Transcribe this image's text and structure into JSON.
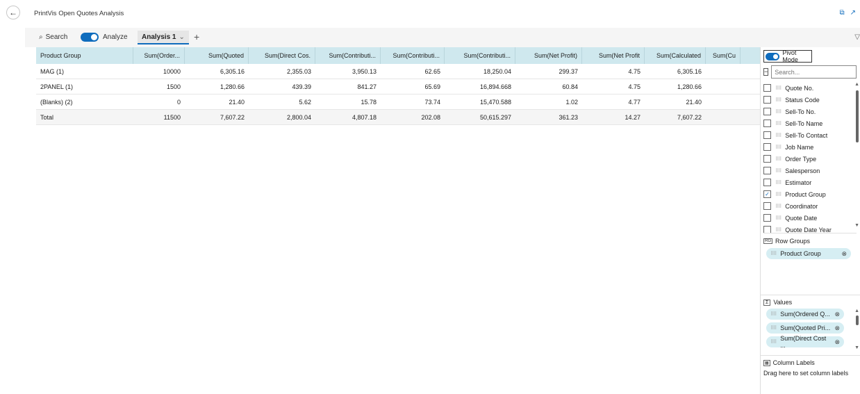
{
  "app": {
    "title": "PrintVis Open Quotes Analysis"
  },
  "toolbar": {
    "search_label": "Search",
    "analyze_label": "Analyze",
    "tab_label": "Analysis 1",
    "add_label": "+"
  },
  "grid": {
    "headers": [
      "Product Group",
      "Sum(Order...",
      "Sum(Quoted",
      "Sum(Direct Cos.",
      "Sum(Contributi...",
      "Sum(Contributi...",
      "Sum(Contributi...",
      "Sum(Net Profit)",
      "Sum(Net Profit",
      "Sum(Calculated",
      "Sum(Cu"
    ],
    "rows": [
      [
        "MAG (1)",
        "10000",
        "6,305.16",
        "2,355.03",
        "3,950.13",
        "62.65",
        "18,250.04",
        "299.37",
        "4.75",
        "6,305.16",
        ""
      ],
      [
        "2PANEL (1)",
        "1500",
        "1,280.66",
        "439.39",
        "841.27",
        "65.69",
        "16,894.668",
        "60.84",
        "4.75",
        "1,280.66",
        ""
      ],
      [
        "(Blanks) (2)",
        "0",
        "21.40",
        "5.62",
        "15.78",
        "73.74",
        "15,470.588",
        "1.02",
        "4.77",
        "21.40",
        ""
      ],
      [
        "Total",
        "11500",
        "7,607.22",
        "2,800.04",
        "4,807.18",
        "202.08",
        "50,615.297",
        "361.23",
        "14.27",
        "7,607.22",
        ""
      ]
    ]
  },
  "panel": {
    "pivot_mode_label": "Pivot Mode",
    "search_placeholder": "Search...",
    "columns": [
      {
        "label": "Quote No.",
        "checked": false
      },
      {
        "label": "Status Code",
        "checked": false
      },
      {
        "label": "Sell-To No.",
        "checked": false
      },
      {
        "label": "Sell-To Name",
        "checked": false
      },
      {
        "label": "Sell-To Contact",
        "checked": false
      },
      {
        "label": "Job Name",
        "checked": false
      },
      {
        "label": "Order Type",
        "checked": false
      },
      {
        "label": "Salesperson",
        "checked": false
      },
      {
        "label": "Estimator",
        "checked": false
      },
      {
        "label": "Product Group",
        "checked": true
      },
      {
        "label": "Coordinator",
        "checked": false
      },
      {
        "label": "Quote Date",
        "checked": false
      },
      {
        "label": "Quote Date Year",
        "checked": false
      }
    ],
    "row_groups_label": "Row Groups",
    "row_group_chip": "Product Group",
    "values_label": "Values",
    "value_chips": [
      "Sum(Ordered Q...",
      "Sum(Quoted Pri...",
      "Sum(Direct Cost ..."
    ],
    "column_labels_label": "Column Labels",
    "column_labels_hint": "Drag here to set column labels"
  }
}
